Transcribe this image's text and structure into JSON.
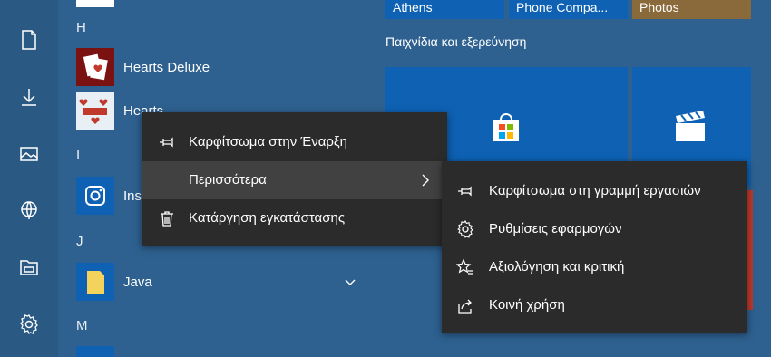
{
  "rail": {
    "icons": [
      "document-icon",
      "download-icon",
      "pictures-icon",
      "network-icon",
      "file-explorer-icon",
      "gear-icon"
    ]
  },
  "app_list": {
    "letter_h": "H",
    "letter_i": "I",
    "letter_j": "J",
    "letter_m": "M",
    "hearts_deluxe": "Hearts Deluxe",
    "hearts": "Hearts",
    "instagram": "Ins",
    "java": "Java"
  },
  "tiles": {
    "athens": "Athens",
    "phone_companion": "Phone Compa...",
    "photos": "Photos",
    "section_title": "Παιχνίδια και εξερεύνηση"
  },
  "context_menu": {
    "pin_start": "Καρφίτσωμα στην Έναρξη",
    "more": "Περισσότερα",
    "uninstall": "Κατάργηση εγκατάστασης"
  },
  "submenu": {
    "pin_taskbar": "Καρφίτσωμα στη γραμμή εργασιών",
    "app_settings": "Ρυθμίσεις εφαρμογών",
    "rate_review": "Αξιολόγηση και κριτική",
    "share": "Κοινή χρήση"
  },
  "colors": {
    "background": "#2d5f8a",
    "tile_blue": "#0e61b3",
    "menu_bg": "#2b2b2b",
    "menu_highlight": "#414141",
    "red_accent": "#c0392b"
  }
}
